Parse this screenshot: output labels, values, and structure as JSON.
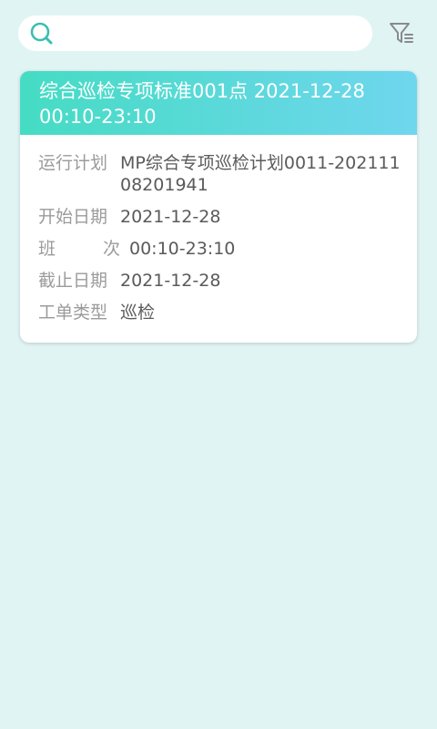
{
  "search": {
    "placeholder": "",
    "value": "",
    "icon": "search-icon",
    "icon_color": "#3bbfb0"
  },
  "filter": {
    "icon": "filter-icon",
    "icon_color": "#8a8a8a"
  },
  "colors": {
    "background": "#e1f4f4",
    "header_gradient_start": "#45dcc3",
    "header_gradient_end": "#6fd6ee"
  },
  "card": {
    "title": "综合巡检专项标准001点 2021-12-28 00:10-23:10",
    "fields": [
      {
        "label": "运行计划",
        "value": "MP综合专项巡检计划0011-20211108201941"
      },
      {
        "label": "开始日期",
        "value": "2021-12-28"
      },
      {
        "label_parts": [
          "班",
          "次"
        ],
        "value": "00:10-23:10"
      },
      {
        "label": "截止日期",
        "value": "2021-12-28"
      },
      {
        "label": "工单类型",
        "value": "巡检"
      }
    ]
  }
}
